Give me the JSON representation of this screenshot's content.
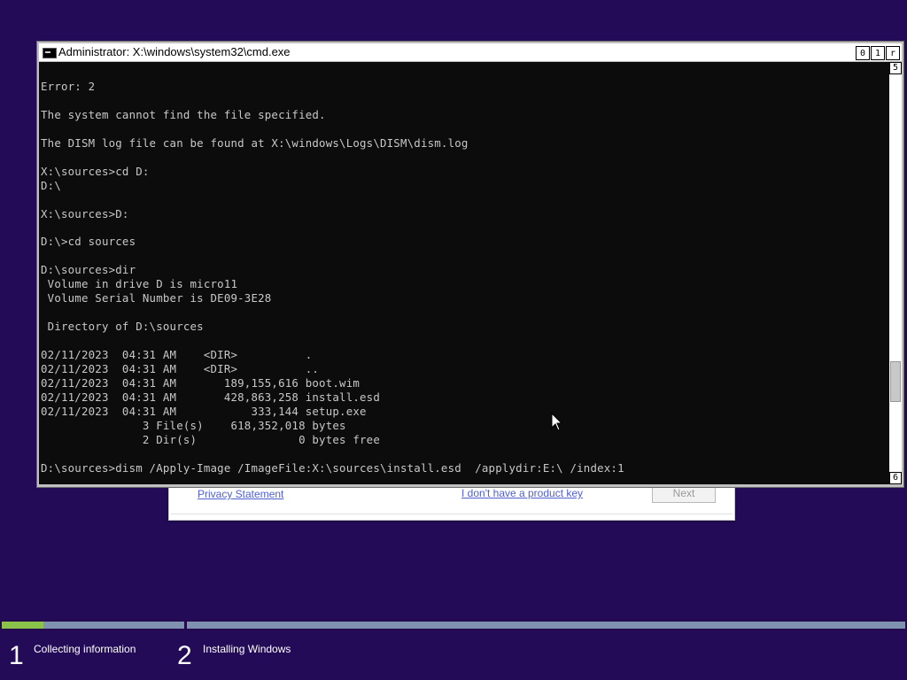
{
  "window": {
    "title": "Administrator: X:\\windows\\system32\\cmd.exe",
    "buttons": {
      "minimize": "0",
      "maximize": "1",
      "close": "r"
    },
    "scroll_up": "5",
    "scroll_down": "6"
  },
  "console": {
    "text": "\nError: 2\n\nThe system cannot find the file specified.\n\nThe DISM log file can be found at X:\\windows\\Logs\\DISM\\dism.log\n\nX:\\sources>cd D:\nD:\\\n\nX:\\sources>D:\n\nD:\\>cd sources\n\nD:\\sources>dir\n Volume in drive D is micro11\n Volume Serial Number is DE09-3E28\n\n Directory of D:\\sources\n\n02/11/2023  04:31 AM    <DIR>          .\n02/11/2023  04:31 AM    <DIR>          ..\n02/11/2023  04:31 AM       189,155,616 boot.wim\n02/11/2023  04:31 AM       428,863,258 install.esd\n02/11/2023  04:31 AM           333,144 setup.exe\n               3 File(s)    618,352,018 bytes\n               2 Dir(s)               0 bytes free\n\nD:\\sources>dism /Apply-Image /ImageFile:X:\\sources\\install.esd  /applydir:E:\\ /index:1"
  },
  "setup": {
    "privacy_link": "Privacy Statement",
    "no_product_key_link": "I don't have a product key",
    "next_button": "Next"
  },
  "steps": [
    {
      "number": "1",
      "label": "Collecting information"
    },
    {
      "number": "2",
      "label": "Installing Windows"
    }
  ],
  "progress": {
    "step1_fraction": 0.23,
    "step2_fraction": 0
  },
  "colors": {
    "desktop_background": "#230b57",
    "progress_fill": "#8bc34a",
    "progress_track": "#7f93b0",
    "link": "#4f5fd0"
  },
  "icons": {
    "window_icon": "cmd-icon",
    "cursor": "mouse-pointer-icon"
  }
}
